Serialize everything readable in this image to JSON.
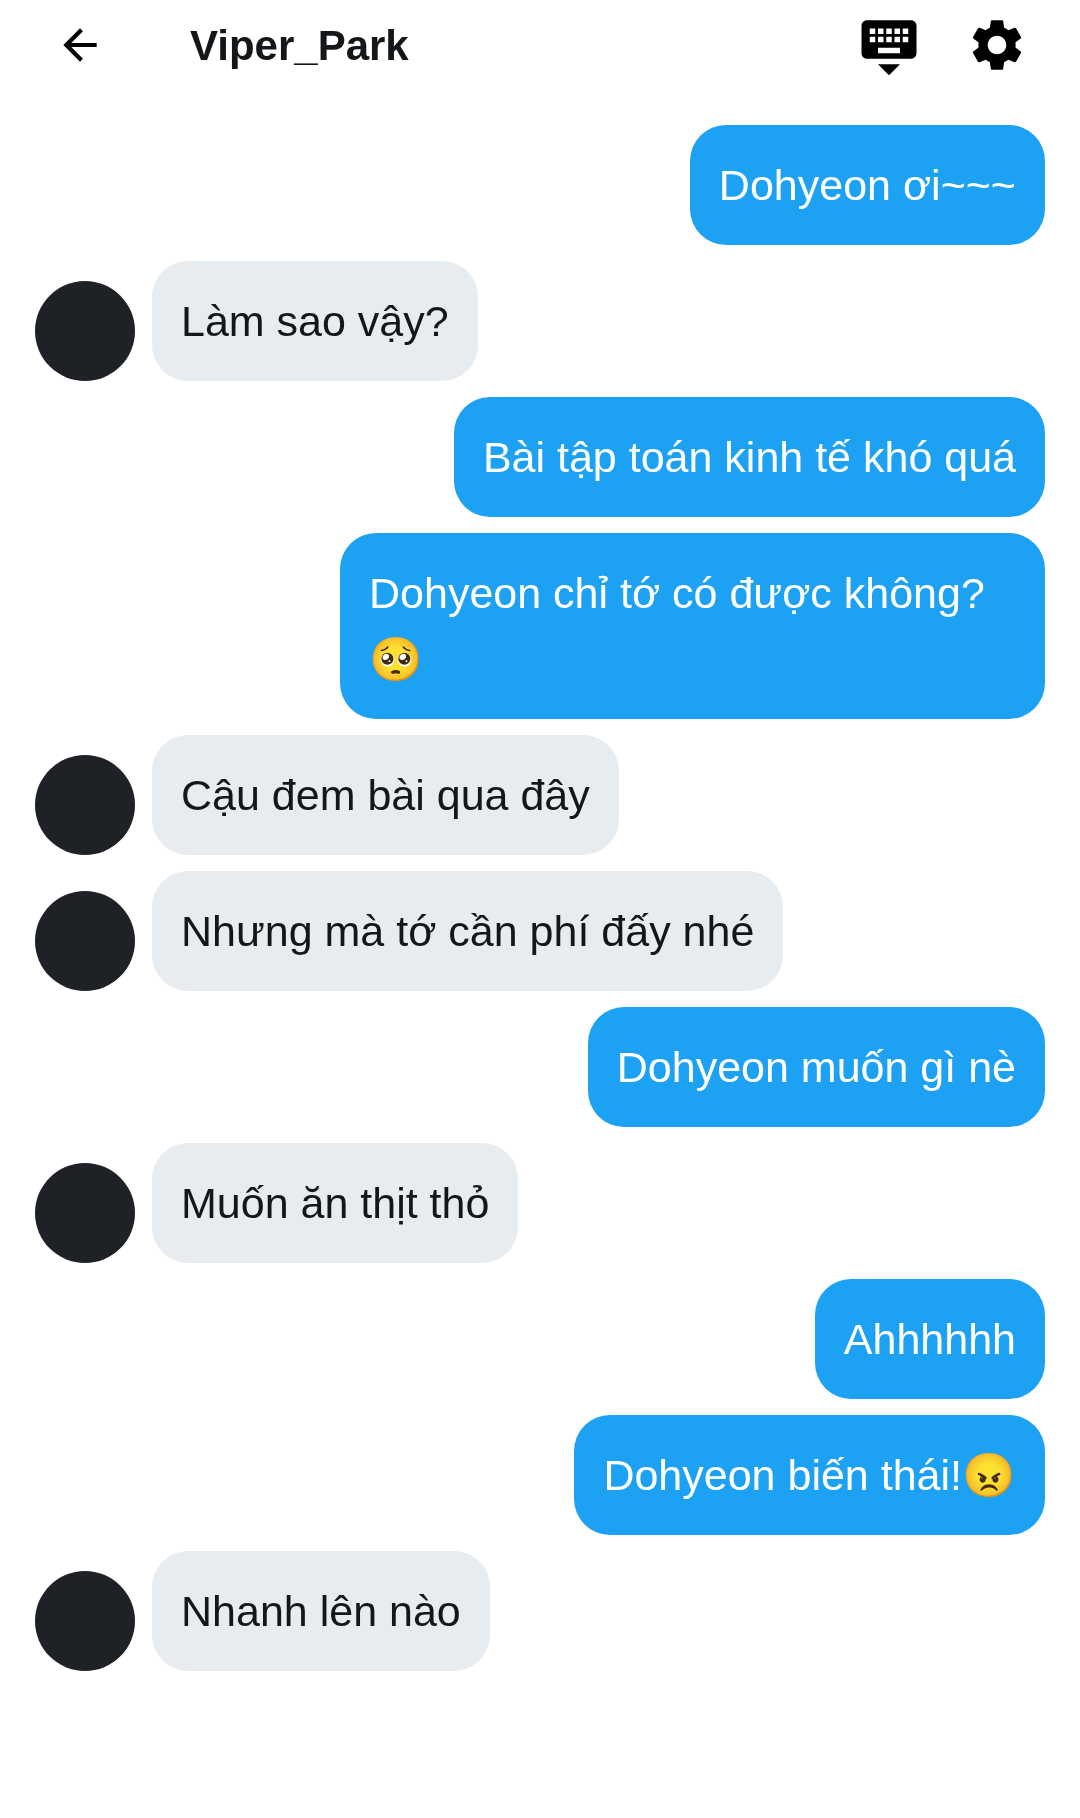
{
  "header": {
    "title": "Viper_Park"
  },
  "messages": [
    {
      "kind": "sent",
      "text": "Dohyeon ơi~~~"
    },
    {
      "kind": "received",
      "text": "Làm sao vậy?"
    },
    {
      "kind": "sent",
      "text": "Bài tập toán kinh tế khó quá"
    },
    {
      "kind": "sent",
      "text": "Dohyeon chỉ tớ có được không?🥺"
    },
    {
      "kind": "received",
      "text": "Cậu đem bài qua đây"
    },
    {
      "kind": "received",
      "text": "Nhưng mà tớ cần phí đấy nhé"
    },
    {
      "kind": "sent",
      "text": "Dohyeon muốn gì nè"
    },
    {
      "kind": "received",
      "text": "Muốn ăn thịt thỏ"
    },
    {
      "kind": "sent",
      "text": "Ahhhhhh"
    },
    {
      "kind": "sent",
      "text": "Dohyeon biến thái!😠"
    },
    {
      "kind": "received",
      "text": "Nhanh lên nào"
    }
  ]
}
